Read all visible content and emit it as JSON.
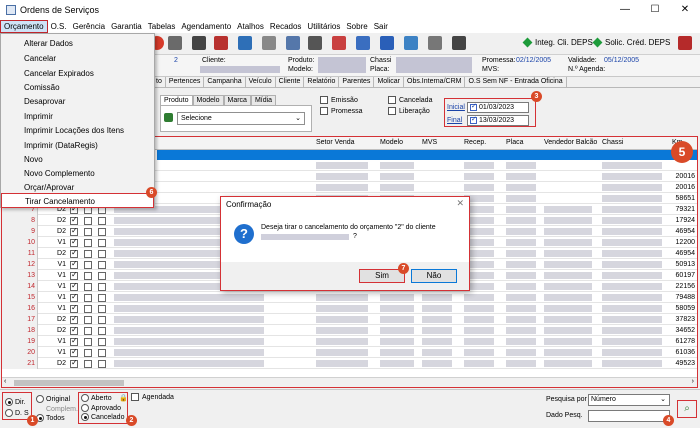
{
  "window": {
    "title": "Ordens de Serviços",
    "minimize": "—",
    "maximize": "☐",
    "close": "✕"
  },
  "menu": [
    "Orçamento",
    "O.S.",
    "Gerência",
    "Garantia",
    "Tabelas",
    "Agendamento",
    "Atalhos",
    "Recados",
    "Utilitários",
    "Sobre",
    "Sair"
  ],
  "toolbar": {
    "integ": "Integ. Cli. DEPS",
    "solic": "Solic. Créd. DEPS"
  },
  "info": {
    "number": "2",
    "cliente_label": "Cliente:",
    "produto_label": "Produto:",
    "modelo_label": "Modelo:",
    "chassi_label": "Chassi",
    "placa_label": "Placa:",
    "promessa_label": "Promessa:",
    "promessa_value": "02/12/2005",
    "mvs_label": "MVS:",
    "validade_label": "Validade:",
    "validade_value": "05/12/2005",
    "agenda_label": "N.º Agenda:"
  },
  "tabs": [
    "to",
    "Pertences",
    "Campanha",
    "Veículo",
    "Cliente",
    "Relatório",
    "Parentes",
    "Molicar",
    "Obs.Interna/CRM",
    "O.S Sem NF - Entrada Oficina"
  ],
  "filters": {
    "subtabs": [
      "Produto",
      "Modelo",
      "Marca",
      "Mídia"
    ],
    "produto_select": "Selecione",
    "checks": {
      "emissao": "Emissão",
      "promessa": "Promessa",
      "cancelada": "Cancelada",
      "liberacao": "Liberação"
    },
    "inicial_label": "Inicial",
    "inicial_value": "01/03/2023",
    "final_label": "Final",
    "final_value": "13/03/2023"
  },
  "dropdown": {
    "items": [
      "Alterar Dados",
      "Cancelar",
      "Cancelar Expirados",
      "Comissão",
      "Desaprovar",
      "Imprimir",
      "Imprimir Locações dos Itens",
      "Imprimir (DataRegis)",
      "Novo",
      "Novo Complemento",
      "Orçar/Aprovar",
      "Tirar Cancelamento"
    ],
    "highlighted": "Tirar Cancelamento"
  },
  "grid": {
    "headers": {
      "setor": "Setor Venda",
      "modelo": "Modelo",
      "mvs": "MVS",
      "recep": "Recep.",
      "placa": "Placa",
      "vendedor": "Vendedor Balcão",
      "chassi": "Chassi",
      "km": "Km"
    },
    "rows": [
      {
        "n": "7",
        "code": "D2",
        "c1": true,
        "c2": false,
        "c3": false,
        "km": "79321"
      },
      {
        "n": "8",
        "code": "D2",
        "c1": true,
        "c2": false,
        "c3": false,
        "km": "17924"
      },
      {
        "n": "9",
        "code": "D2",
        "c1": true,
        "c2": false,
        "c3": false,
        "km": "46954"
      },
      {
        "n": "10",
        "code": "V1",
        "c1": true,
        "c2": false,
        "c3": false,
        "km": "12200"
      },
      {
        "n": "11",
        "code": "D2",
        "c1": true,
        "c2": false,
        "c3": false,
        "km": "46954"
      },
      {
        "n": "12",
        "code": "V1",
        "c1": true,
        "c2": false,
        "c3": false,
        "km": "50913"
      },
      {
        "n": "13",
        "code": "V1",
        "c1": true,
        "c2": false,
        "c3": false,
        "km": "60197"
      },
      {
        "n": "14",
        "code": "V1",
        "c1": true,
        "c2": false,
        "c3": false,
        "km": "22156"
      },
      {
        "n": "15",
        "code": "V1",
        "c1": true,
        "c2": false,
        "c3": false,
        "km": "79488"
      },
      {
        "n": "16",
        "code": "V1",
        "c1": true,
        "c2": false,
        "c3": false,
        "km": "58059"
      },
      {
        "n": "17",
        "code": "D2",
        "c1": true,
        "c2": false,
        "c3": false,
        "km": "37823"
      },
      {
        "n": "18",
        "code": "D2",
        "c1": true,
        "c2": false,
        "c3": false,
        "km": "34652"
      },
      {
        "n": "19",
        "code": "V1",
        "c1": true,
        "c2": false,
        "c3": false,
        "km": "61278"
      },
      {
        "n": "20",
        "code": "V1",
        "c1": true,
        "c2": false,
        "c3": false,
        "km": "61036"
      },
      {
        "n": "21",
        "code": "D2",
        "c1": true,
        "c2": false,
        "c3": false,
        "km": "49523"
      }
    ],
    "top_km": [
      "20016",
      "20016",
      "20016",
      "58651"
    ]
  },
  "dialog": {
    "title": "Confirmação",
    "message": "Deseja tirar o cancelamento do orçamento \"2\" do cliente",
    "message2": "?",
    "yes": "Sim",
    "no": "Não",
    "close": "✕"
  },
  "bottom": {
    "dir": "Dir.",
    "d_s": "D. S",
    "original": "Original",
    "complem": "Complem.",
    "todos": "Todos",
    "aberto": "Aberto",
    "aprovado": "Aprovado",
    "cancelado": "Cancelado",
    "agendada": "Agendada",
    "pesquisa_label": "Pesquisa por",
    "pesquisa_value": "Número",
    "dado_label": "Dado Pesq."
  },
  "badges": [
    "1",
    "2",
    "3",
    "4",
    "5",
    "6",
    "7"
  ],
  "colors": {
    "highlight": "#d43135",
    "badge": "#d94a28",
    "selection": "#0a78d7",
    "link": "#1a43a8"
  }
}
